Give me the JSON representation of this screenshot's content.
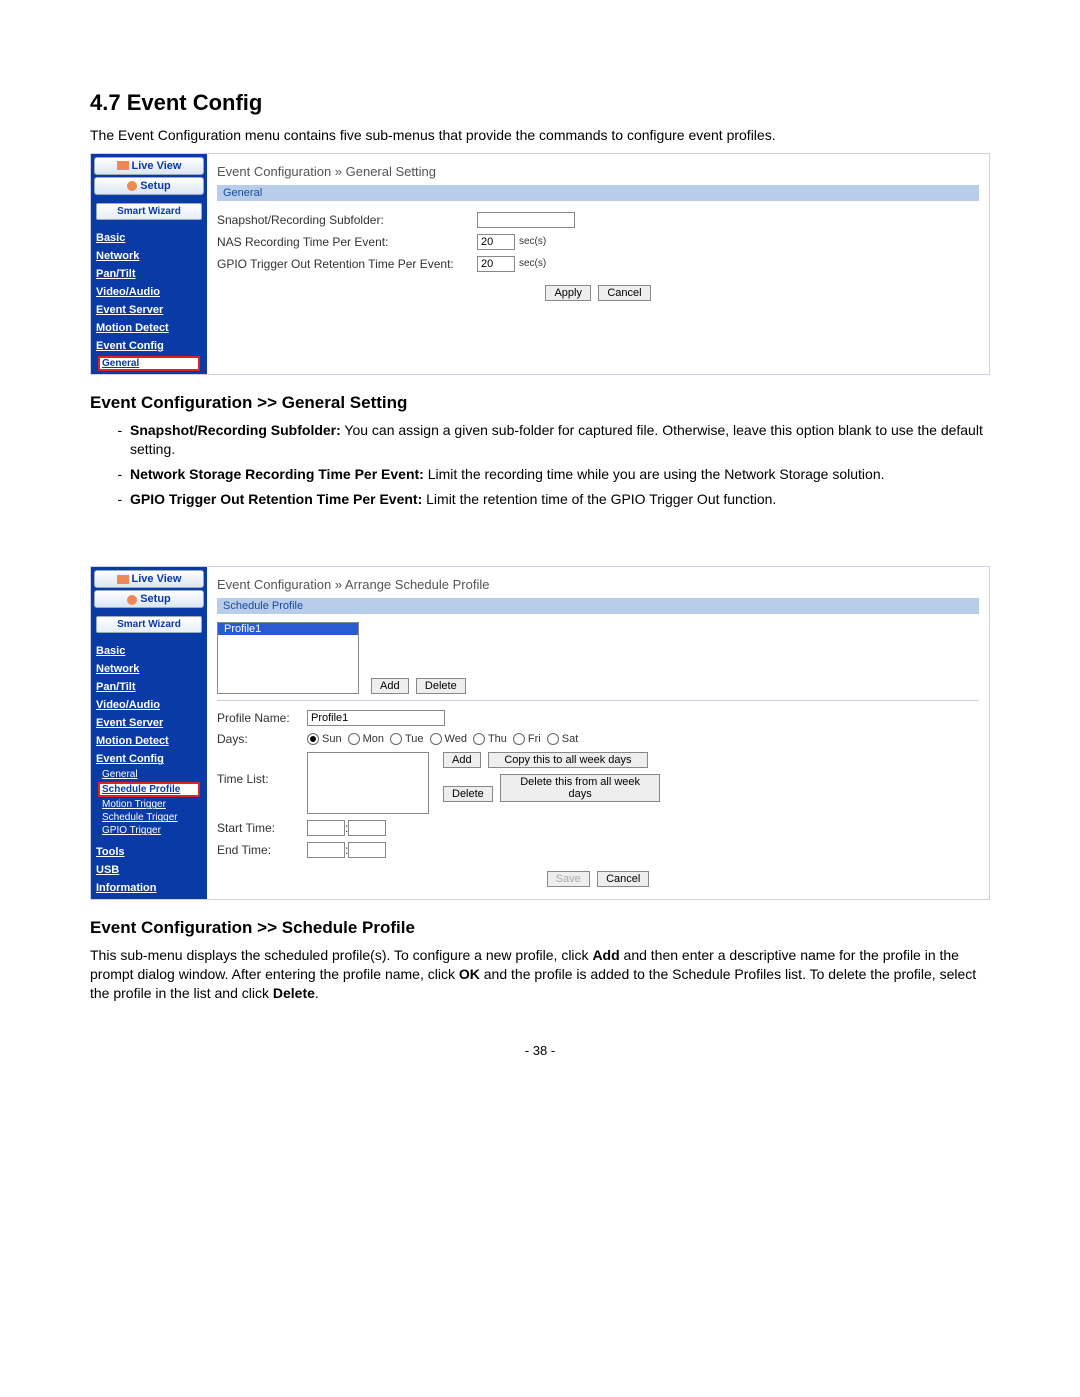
{
  "heading": "4.7  Event Config",
  "intro": "The Event Configuration menu contains five sub-menus that provide the commands to configure event profiles.",
  "shot1": {
    "sidebar": {
      "live": "Live View",
      "setup": "Setup",
      "wizard": "Smart Wizard",
      "items": [
        "Basic",
        "Network",
        "Pan/Tilt",
        "Video/Audio",
        "Event Server",
        "Motion Detect",
        "Event Config"
      ],
      "sub": "General"
    },
    "breadcrumb": "Event Configuration » General Setting",
    "group": "General",
    "rows": {
      "r1": "Snapshot/Recording Subfolder:",
      "r2": "NAS Recording Time Per Event:",
      "r3": "GPIO Trigger Out Retention Time Per Event:"
    },
    "val2": "20",
    "val3": "20",
    "unit": "sec(s)",
    "apply": "Apply",
    "cancel": "Cancel"
  },
  "sub1_title": "Event Configuration >> General Setting",
  "bullets1": {
    "b1_bold": "Snapshot/Recording Subfolder:",
    "b1_rest": " You can assign a given sub-folder for captured file. Otherwise, leave this option blank to use the default setting.",
    "b2_bold": "Network Storage Recording Time Per Event:",
    "b2_rest": " Limit the recording time while you are using the Network Storage solution.",
    "b3_bold": "GPIO Trigger Out Retention Time Per Event:",
    "b3_rest": " Limit the retention time of the GPIO Trigger Out function."
  },
  "shot2": {
    "sidebar": {
      "live": "Live View",
      "setup": "Setup",
      "wizard": "Smart Wizard",
      "items": [
        "Basic",
        "Network",
        "Pan/Tilt",
        "Video/Audio",
        "Event Server",
        "Motion Detect",
        "Event Config"
      ],
      "subs": [
        "General",
        "Schedule Profile",
        "Motion Trigger",
        "Schedule Trigger",
        "GPIO Trigger"
      ],
      "tail": [
        "Tools",
        "USB",
        "Information"
      ]
    },
    "breadcrumb": "Event Configuration » Arrange Schedule Profile",
    "group": "Schedule Profile",
    "profile_item": "Profile1",
    "add": "Add",
    "delete": "Delete",
    "profile_name_lbl": "Profile Name:",
    "profile_name_val": "Profile1",
    "days_lbl": "Days:",
    "days": [
      "Sun",
      "Mon",
      "Tue",
      "Wed",
      "Thu",
      "Fri",
      "Sat"
    ],
    "timelist_lbl": "Time List:",
    "copy": "Copy this to all week days",
    "delall": "Delete this from all week days",
    "start_lbl": "Start Time:",
    "end_lbl": "End Time:",
    "save": "Save",
    "cancel": "Cancel"
  },
  "sub2_title": "Event Configuration >> Schedule Profile",
  "para2_a": "This sub-menu displays the scheduled profile(s). To configure a new profile, click ",
  "para2_add": "Add",
  "para2_b": " and then enter a descriptive name for the profile in the prompt dialog window. After entering the profile name, click ",
  "para2_ok": "OK",
  "para2_c": " and the profile is added to the Schedule Profiles list. To delete the profile, select the profile in the list and click ",
  "para2_del": "Delete",
  "para2_d": ".",
  "pagenum": "- 38 -"
}
